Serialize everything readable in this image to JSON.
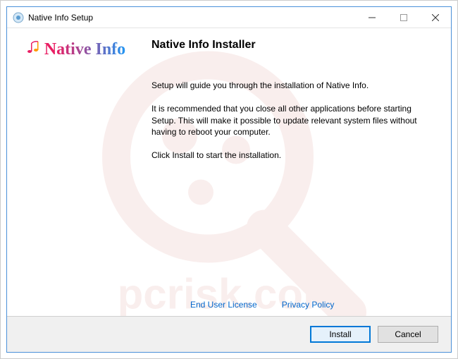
{
  "window": {
    "title": "Native Info Setup"
  },
  "sidebar": {
    "logo_text": "Native Info"
  },
  "main": {
    "heading": "Native Info Installer",
    "para1": "Setup will guide you through the installation of Native Info.",
    "para2": "It is recommended that you close all other applications before starting Setup. This will make it possible to update relevant system files without having to reboot your computer.",
    "para3": "Click Install to start the installation."
  },
  "links": {
    "eula": "End User License",
    "privacy": "Privacy Policy"
  },
  "footer": {
    "install": "Install",
    "cancel": "Cancel"
  },
  "watermark": {
    "text": "pcrisk.com"
  }
}
